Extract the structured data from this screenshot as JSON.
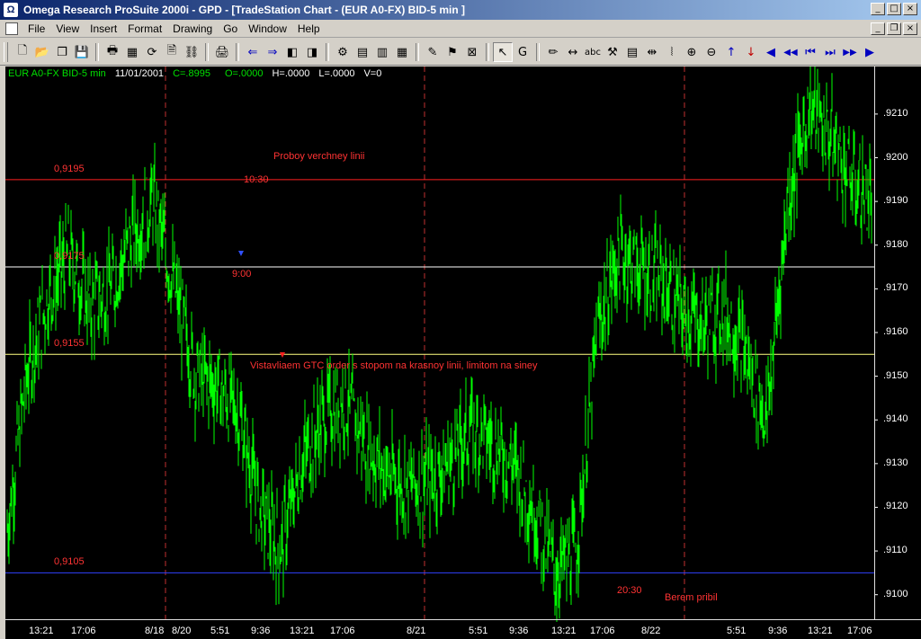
{
  "window": {
    "app_icon": "Ω",
    "title": "Omega Research ProSuite 2000i - GPD - [TradeStation Chart - (EUR A0-FX)  BID-5 min ]",
    "min_glyph": "_",
    "max_glyph": "□",
    "close_glyph": "×",
    "mdi_min_glyph": "_",
    "mdi_restore_glyph": "❐",
    "mdi_close_glyph": "×"
  },
  "menu": [
    "File",
    "View",
    "Insert",
    "Format",
    "Drawing",
    "Go",
    "Window",
    "Help"
  ],
  "toolbar_icons": [
    {
      "name": "new-document-icon",
      "glyph": "🗋"
    },
    {
      "name": "open-folder-icon",
      "glyph": "📂"
    },
    {
      "name": "copy-windows-icon",
      "glyph": "❐"
    },
    {
      "name": "save-icon",
      "glyph": "💾"
    },
    {
      "sep": true
    },
    {
      "name": "print-preview-icon",
      "glyph": "🖶"
    },
    {
      "name": "format-icon",
      "glyph": "▦"
    },
    {
      "name": "refresh-icon",
      "glyph": "⟳"
    },
    {
      "name": "page-icon",
      "glyph": "🗎"
    },
    {
      "name": "link-icon",
      "glyph": "⛓"
    },
    {
      "sep": true
    },
    {
      "name": "printer-icon",
      "glyph": "🖨"
    },
    {
      "sep": true
    },
    {
      "name": "back-icon",
      "glyph": "⇐",
      "cls": "blue"
    },
    {
      "name": "forward-icon",
      "glyph": "⇒",
      "cls": "blue"
    },
    {
      "name": "window-left-icon",
      "glyph": "◧"
    },
    {
      "name": "window-right-icon",
      "glyph": "◨"
    },
    {
      "sep": true
    },
    {
      "name": "data-icon",
      "glyph": "⚙"
    },
    {
      "name": "calendar-icon",
      "glyph": "▤"
    },
    {
      "name": "grid-icon",
      "glyph": "▥"
    },
    {
      "name": "table-icon",
      "glyph": "▦"
    },
    {
      "sep": true
    },
    {
      "name": "indicator-icon",
      "glyph": "✎"
    },
    {
      "name": "strategy-icon",
      "glyph": "⚑"
    },
    {
      "name": "scan-icon",
      "glyph": "⊠"
    },
    {
      "sep": true
    },
    {
      "name": "cursor-icon",
      "glyph": "↖",
      "cls": "pressed"
    },
    {
      "name": "text-cursor-icon",
      "glyph": "G"
    },
    {
      "sep": true
    },
    {
      "name": "pencil-icon",
      "glyph": "✏"
    },
    {
      "name": "horizontal-arrow-icon",
      "glyph": "↔"
    },
    {
      "name": "text-icon",
      "glyph": "abc",
      "cls": "small"
    },
    {
      "name": "hammer-icon",
      "glyph": "⚒"
    },
    {
      "name": "notes-icon",
      "glyph": "▤"
    },
    {
      "name": "split-icon",
      "glyph": "⇹"
    },
    {
      "name": "bracket-icon",
      "glyph": "⦚"
    },
    {
      "name": "zoom-in-icon",
      "glyph": "⊕"
    },
    {
      "name": "zoom-out-icon",
      "glyph": "⊖"
    },
    {
      "name": "arrow-up-icon",
      "glyph": "↑",
      "cls": "blue"
    },
    {
      "name": "arrow-down-icon",
      "glyph": "↓",
      "cls": "red"
    },
    {
      "name": "scroll-left-icon",
      "glyph": "◀",
      "cls": "blue"
    },
    {
      "name": "fast-back-icon",
      "glyph": "◀◀",
      "cls": "blue small"
    },
    {
      "name": "to-start-icon",
      "glyph": "⏮",
      "cls": "blue"
    },
    {
      "name": "to-end-icon",
      "glyph": "⏭",
      "cls": "blue"
    },
    {
      "name": "fast-forward-icon",
      "glyph": "▶▶",
      "cls": "blue small"
    },
    {
      "name": "scroll-right-icon",
      "glyph": "▶",
      "cls": "blue"
    }
  ],
  "chart_info": {
    "symbol": "EUR A0-FX BID-5 min",
    "date": "11/01/2001",
    "close": "C=.8995",
    "open": "O=.0000",
    "high": "H=.0000",
    "low": "L=.0000",
    "volume": "V=0"
  },
  "colors": {
    "price": "#00ff00",
    "red_line": "#ff2020",
    "white_line": "#ffffff",
    "yellow_line": "#ffff80",
    "blue_line": "#3040ff",
    "session_divider": "#c03030"
  },
  "levels": [
    {
      "label": "0,9195",
      "value": 0.9195,
      "color": "#ff2020"
    },
    {
      "label": "0,9175",
      "value": 0.9175,
      "color": "#ffffff"
    },
    {
      "label": "0,9155",
      "value": 0.9155,
      "color": "#ffff80"
    },
    {
      "label": "0,9105",
      "value": 0.9105,
      "color": "#3040ff"
    }
  ],
  "annotations": {
    "breakout": "Proboy verchney linii",
    "order": "Vistavliaem GTC order s stopom na krasnoy linii, limitom na siney",
    "profit": "Berem pribil",
    "t1030": "10:30",
    "t900": "9:00",
    "t2030": "20:30"
  },
  "chart_data": {
    "type": "line",
    "x": [
      "13:21",
      "17:06",
      "8/18",
      "8/20",
      "5:51",
      "9:36",
      "13:21",
      "17:06",
      "8/21",
      "5:51",
      "9:36",
      "13:21",
      "17:06",
      "8/22",
      "5:51",
      "9:36",
      "13:21",
      "17:06"
    ],
    "series": [
      {
        "values": [
          0.9112,
          0.915,
          0.9168,
          0.9178,
          0.9166,
          0.917,
          0.9182,
          0.919,
          0.917,
          0.915,
          0.9148,
          0.9142,
          0.912,
          0.911,
          0.913,
          0.914,
          0.9145,
          0.9135,
          0.9128,
          0.9125,
          0.9126,
          0.913,
          0.9138,
          0.9135,
          0.913,
          0.912,
          0.9105,
          0.911,
          0.916,
          0.9178,
          0.9175,
          0.9172,
          0.9165,
          0.9162,
          0.9165,
          0.9155,
          0.914,
          0.919,
          0.9212,
          0.9205,
          0.9195,
          0.919
        ]
      }
    ],
    "y_ticks": [
      ".9210",
      ".9200",
      ".9190",
      ".9180",
      ".9170",
      ".9160",
      ".9150",
      ".9140",
      ".9130",
      ".9120",
      ".9110",
      ".9100"
    ],
    "ylim": [
      0.9095,
      0.9218
    ],
    "session_dividers": [
      "8/18",
      "8/21",
      "8/22",
      "end"
    ],
    "grid": false,
    "legend": "none"
  }
}
